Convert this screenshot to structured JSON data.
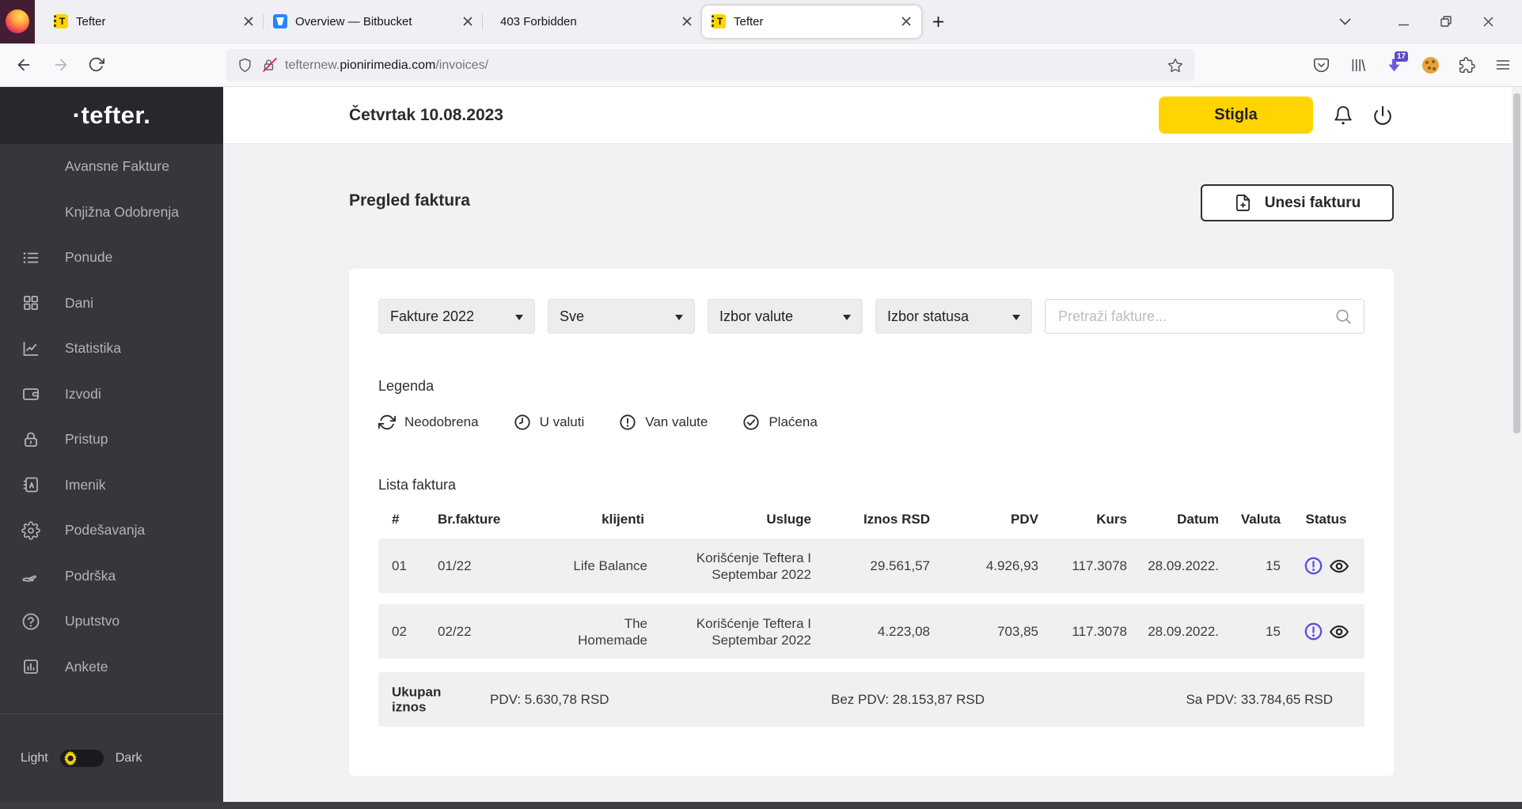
{
  "colors": {
    "brand_yellow": "#ffd400",
    "status_purple": "#5b4fd9",
    "bitbucket_blue": "#2684ff",
    "sidebar_bg": "#36373d"
  },
  "browser": {
    "favicon_letter": "T",
    "tabs": [
      {
        "title": "Tefter",
        "favicon": "tefter-icon"
      },
      {
        "title": "Overview — Bitbucket",
        "favicon": "bitbucket-icon"
      },
      {
        "title": "403 Forbidden",
        "favicon": ""
      },
      {
        "title": "Tefter",
        "favicon": "tefter-icon"
      }
    ],
    "url_subdomain": "tefternew.",
    "url_domain": "pionirimedia.com",
    "url_path": "/invoices/",
    "extension_badge": "17",
    "toolbar_icons": [
      "back-icon",
      "forward-icon",
      "reload-icon",
      "shield-icon",
      "lock-slash-icon",
      "star-icon",
      "pocket-icon",
      "library-icon",
      "downloads-extension-icon",
      "cookie-icon",
      "extensions-puzzle-icon",
      "menu-icon"
    ],
    "window_icons": [
      "list-all-tabs-icon",
      "minimize-icon",
      "restore-icon",
      "close-icon"
    ]
  },
  "sidebar": {
    "logo": "·tefter.",
    "items": [
      {
        "label": "Avansne Fakture",
        "icon": ""
      },
      {
        "label": "Knjižna Odobrenja",
        "icon": ""
      },
      {
        "label": "Ponude",
        "icon": "list-icon"
      },
      {
        "label": "Dani",
        "icon": "grid-icon"
      },
      {
        "label": "Statistika",
        "icon": "chart-icon"
      },
      {
        "label": "Izvodi",
        "icon": "wallet-icon"
      },
      {
        "label": "Pristup",
        "icon": "lock-icon"
      },
      {
        "label": "Imenik",
        "icon": "address-book-icon"
      },
      {
        "label": "Podešavanja",
        "icon": "gear-icon"
      },
      {
        "label": "Podrška",
        "icon": "support-hand-icon"
      },
      {
        "label": "Uputstvo",
        "icon": "help-circle-icon"
      },
      {
        "label": "Ankete",
        "icon": "poll-icon"
      }
    ],
    "theme": {
      "light": "Light",
      "dark": "Dark"
    }
  },
  "header": {
    "date": "Četvrtak 10.08.2023",
    "status_button": "Stigla"
  },
  "page": {
    "title": "Pregled faktura",
    "add_invoice_button": "Unesi fakturu",
    "filters": [
      {
        "value": "Fakture 2022"
      },
      {
        "value": "Sve"
      },
      {
        "value": "Izbor valute"
      },
      {
        "value": "Izbor statusa"
      }
    ],
    "search_placeholder": "Pretraži fakture...",
    "legend": {
      "title": "Legenda",
      "items": [
        {
          "label": "Neodobrena",
          "icon": "refresh-icon"
        },
        {
          "label": "U valuti",
          "icon": "clock-icon"
        },
        {
          "label": "Van valute",
          "icon": "exclamation-circle-icon"
        },
        {
          "label": "Plaćena",
          "icon": "check-circle-icon"
        }
      ]
    },
    "table": {
      "title": "Lista faktura",
      "columns": [
        "#",
        "Br.fakture",
        "klijenti",
        "Usluge",
        "Iznos RSD",
        "PDV",
        "Kurs",
        "Datum",
        "Valuta",
        "Status"
      ],
      "rows": [
        {
          "num": "01",
          "invoice_no": "01/22",
          "client": "Life Balance",
          "service": "Korišćenje Teftera I Septembar 2022",
          "amount_rsd": "29.561,57",
          "pdv": "4.926,93",
          "kurs": "117.3078",
          "datum": "28.09.2022.",
          "valuta": "15",
          "status_icons": [
            "van-valute-exclamation",
            "view-eye"
          ]
        },
        {
          "num": "02",
          "invoice_no": "02/22",
          "client": "The Homemade",
          "service": "Korišćenje Teftera I Septembar 2022",
          "amount_rsd": "4.223,08",
          "pdv": "703,85",
          "kurs": "117.3078",
          "datum": "28.09.2022.",
          "valuta": "15",
          "status_icons": [
            "van-valute-exclamation",
            "view-eye"
          ]
        }
      ],
      "totals": {
        "label": "Ukupan iznos",
        "pdv": "PDV: 5.630,78 RSD",
        "bez_pdv": "Bez PDV: 28.153,87 RSD",
        "sa_pdv": "Sa PDV: 33.784,65 RSD"
      }
    }
  }
}
